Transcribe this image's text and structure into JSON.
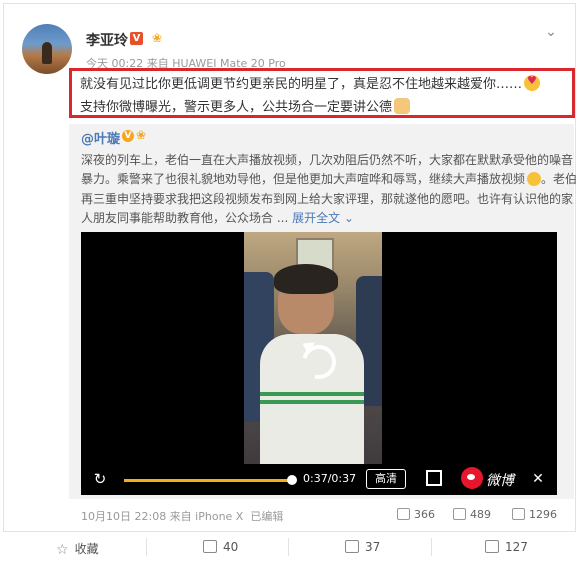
{
  "header": {
    "username": "李亚玲",
    "verified_badge": "V",
    "meta": "今天 00:22 来自 HUAWEI Mate 20 Pro",
    "menu_icon": "chevron-down-icon"
  },
  "post": {
    "line1": "就没有见过比你更低调更节约更亲民的明星了，真是忍不住地越来越爱你……",
    "line2": "支持你微博曝光，警示更多人，公共场合一定要讲公德"
  },
  "repost": {
    "author": "@叶璇",
    "verified_badge": "V",
    "line1": "深夜的列车上，老伯一直在大声播放视频，几次劝阻后仍然不听，大家都在默默承受他的噪音",
    "line2": "暴力。乘警来了也很礼貌地劝导他，但是他更加大声喧哗和辱骂，继续大声播放视频",
    "line3": "。老伯",
    "line3_start": "再三重申坚持要求我把这段视频发布到网上给大家评理，那就遂他的愿吧。也许有认识他的家",
    "line4": "人朋友同事能帮助教育他，公众场合 ...",
    "more": "展开全文",
    "video": {
      "time": "0:37/0:37",
      "progress_fraction": 1.0,
      "hd_label": "高清",
      "brand": "微博"
    },
    "date": "10月10日 22:08 来自 iPhone X",
    "edited": "已编辑",
    "reposts": "366",
    "comments": "489",
    "likes": "1296"
  },
  "actions": {
    "favorite": "收藏",
    "repost": "40",
    "comment": "37",
    "like": "127"
  }
}
